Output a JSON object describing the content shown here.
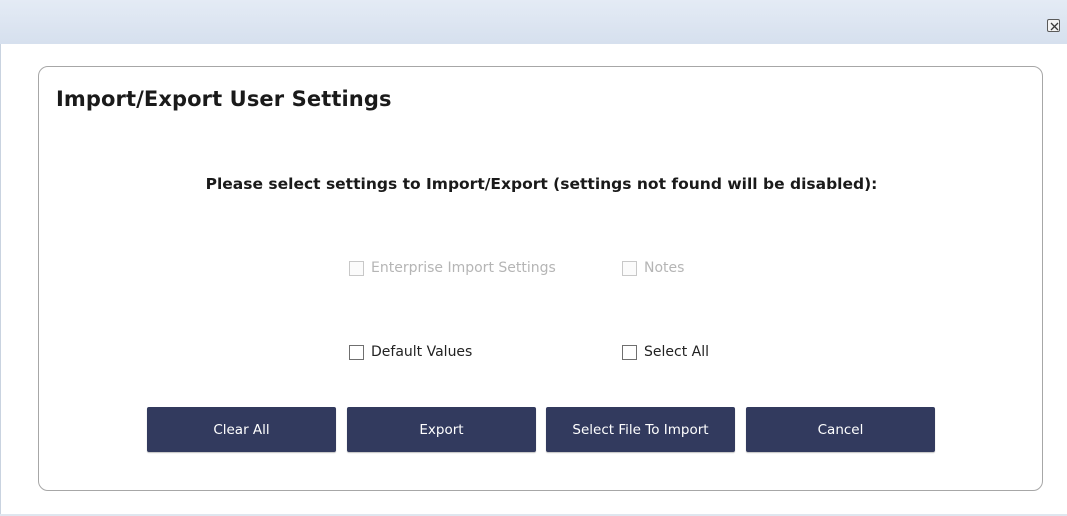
{
  "window": {
    "close_icon": "close-icon"
  },
  "dialog": {
    "title": "Import/Export User Settings",
    "instruction": "Please select settings to Import/Export (settings not found will be disabled):"
  },
  "options": {
    "enterprise_import_settings": {
      "label": "Enterprise Import Settings",
      "checked": false,
      "enabled": false
    },
    "notes": {
      "label": "Notes",
      "checked": false,
      "enabled": false
    },
    "default_values": {
      "label": "Default Values",
      "checked": false,
      "enabled": true
    },
    "select_all": {
      "label": "Select All",
      "checked": false,
      "enabled": true
    }
  },
  "buttons": {
    "clear_all": "Clear All",
    "export": "Export",
    "select_file_to_import": "Select File To Import",
    "cancel": "Cancel"
  },
  "colors": {
    "button_bg": "#323a5e",
    "button_text": "#ffffff",
    "titlebar": "#dbe3ef",
    "disabled_text": "#b5b5b5"
  }
}
